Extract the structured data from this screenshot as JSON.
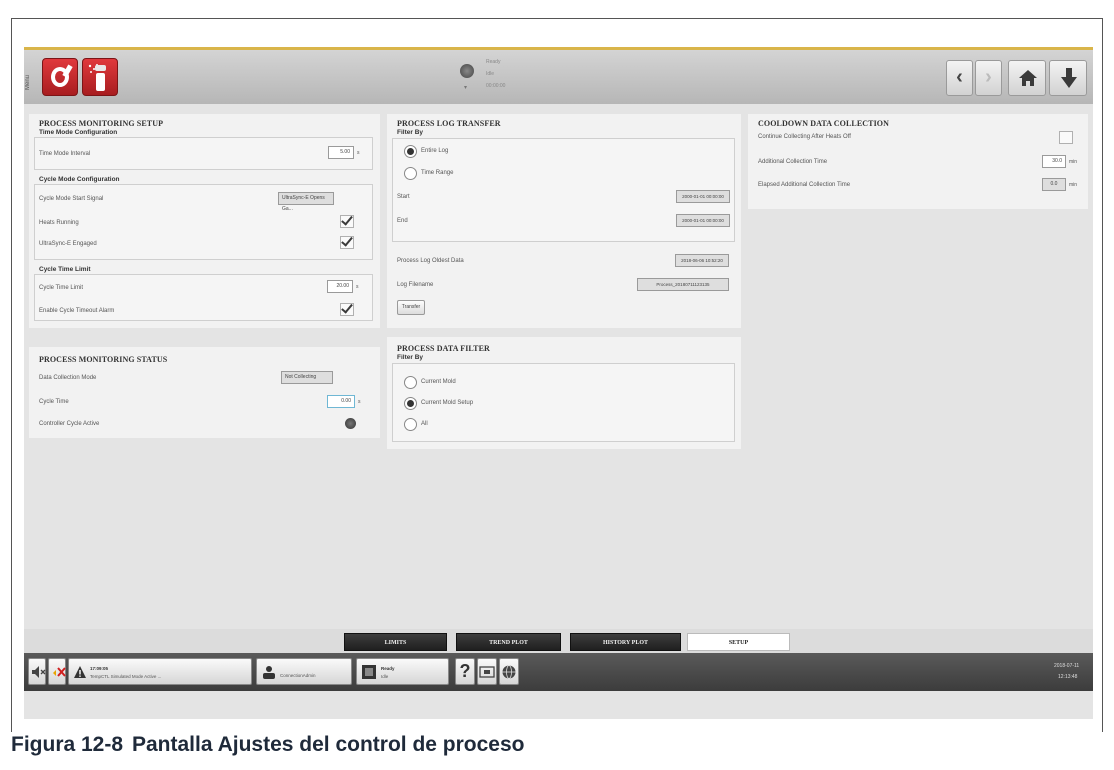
{
  "topbar": {
    "side_text": "Menú",
    "status_lines": [
      "Ready",
      "Idle",
      "00:00:00"
    ],
    "status_sub": "▾"
  },
  "setup": {
    "title": "PROCESS MONITORING SETUP",
    "time_group": "Time Mode Configuration",
    "time_interval_label": "Time Mode Interval",
    "time_interval_value": "5.00",
    "time_interval_unit": "s",
    "cycle_group": "Cycle Mode Configuration",
    "start_signal_label": "Cycle Mode Start Signal",
    "start_signal_value": "UltraSync-E Opens Ga...",
    "heats_running_label": "Heats Running",
    "ultrasync_label": "UltraSync-E Engaged",
    "cycle_limit_group": "Cycle Time Limit",
    "cycle_limit_label": "Cycle Time Limit",
    "cycle_limit_value": "20.00",
    "cycle_limit_unit": "s",
    "timeout_label": "Enable Cycle Timeout Alarm"
  },
  "status": {
    "title": "PROCESS MONITORING STATUS",
    "mode_label": "Data Collection Mode",
    "mode_value": "Not Collecting",
    "cycle_time_label": "Cycle Time",
    "cycle_time_value": "0.00",
    "cycle_time_unit": "s",
    "controller_label": "Controller Cycle Active"
  },
  "log_transfer": {
    "title": "PROCESS LOG TRANSFER",
    "filter_label": "Filter By",
    "opt_entire": "Entire Log",
    "opt_range": "Time Range",
    "start_label": "Start",
    "start_value": "2000-01-01 00:00:00",
    "end_label": "End",
    "end_value": "2000-01-01 00:00:00",
    "oldest_label": "Process Log Oldest Data",
    "oldest_value": "2018-06-06 10:52:20",
    "filename_label": "Log Filename",
    "filename_value": "Process_20180711123135",
    "transfer_label": "Transfer"
  },
  "data_filter": {
    "title": "PROCESS DATA FILTER",
    "filter_label": "Filter By",
    "opt_current_mold": "Current Mold",
    "opt_current_setup": "Current Mold Setup",
    "opt_all": "All"
  },
  "cooldown": {
    "title": "COOLDOWN DATA COLLECTION",
    "continue_label": "Continue Collecting After Heats Off",
    "additional_label": "Additional Collection Time",
    "additional_value": "30.0",
    "additional_unit": "min",
    "elapsed_label": "Elapsed Additional Collection Time",
    "elapsed_value": "0.0",
    "elapsed_unit": "min"
  },
  "tabs": [
    "LIMITS",
    "TREND PLOT",
    "HISTORY PLOT",
    "SETUP"
  ],
  "statusbar": {
    "alarm_time": "17:09:05",
    "alarm_text": "TempCTL Simulated Mode Active ...",
    "user_text": "ConnectionAdmin",
    "mold_title": "Ready",
    "mold_sub": "Idle",
    "help_glyph": "?",
    "date": "2018-07-11",
    "time": "12:13:48"
  },
  "caption": {
    "number": "Figura 12-8",
    "text": "Pantalla Ajustes del control de proceso"
  }
}
